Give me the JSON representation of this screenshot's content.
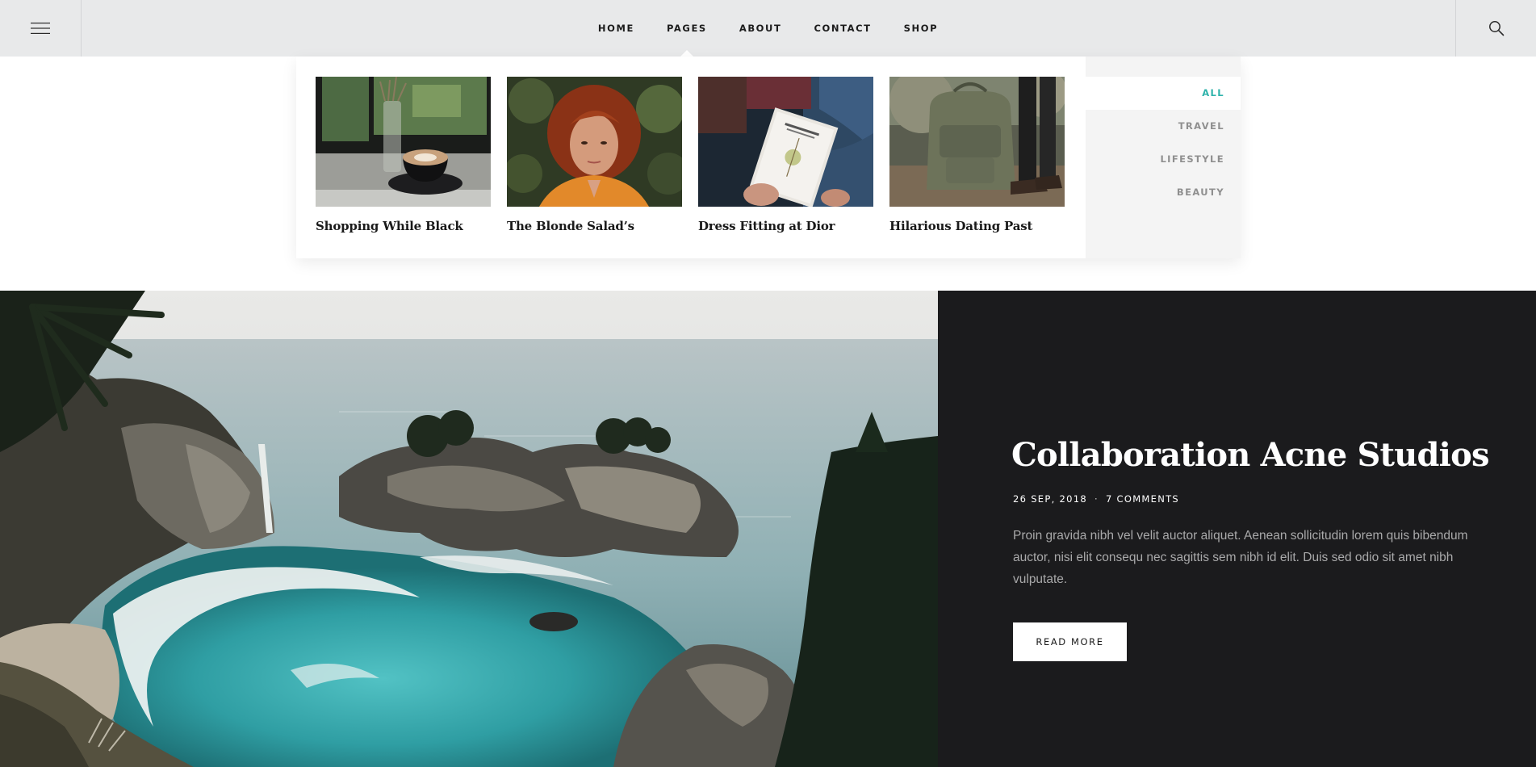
{
  "header": {
    "menu_icon": "hamburger-icon",
    "search_icon": "search-icon",
    "nav": [
      {
        "label": "HOME"
      },
      {
        "label": "PAGES"
      },
      {
        "label": "ABOUT"
      },
      {
        "label": "CONTACT"
      },
      {
        "label": "SHOP"
      }
    ],
    "active_nav": "PAGES"
  },
  "dropdown": {
    "posts": [
      {
        "title": "Shopping While Black"
      },
      {
        "title": "The Blonde Salad’s"
      },
      {
        "title": "Dress Fitting at Dior"
      },
      {
        "title": "Hilarious Dating Past"
      }
    ],
    "categories": [
      {
        "label": "ALL",
        "active": true
      },
      {
        "label": "TRAVEL",
        "active": false
      },
      {
        "label": "LIFESTYLE",
        "active": false
      },
      {
        "label": "BEAUTY",
        "active": false
      }
    ],
    "accent_color": "#2fb3ab"
  },
  "hero": {
    "title": "Collaboration Acne Studios",
    "date": "26 SEP, 2018",
    "separator": "·",
    "comments": "7 COMMENTS",
    "excerpt": "Proin gravida nibh vel velit auctor aliquet. Aenean sollicitudin lorem quis bibendum auctor, nisi elit consequ nec sagittis sem nibh id elit. Duis sed odio sit amet nibh vulputate.",
    "button_label": "READ MORE",
    "panel_color": "#1b1b1d"
  }
}
